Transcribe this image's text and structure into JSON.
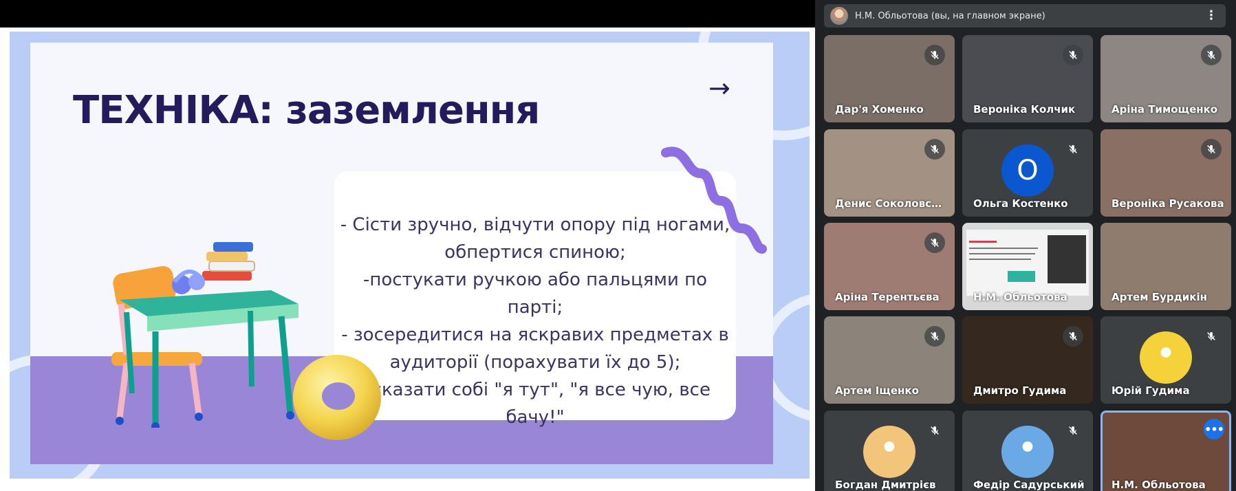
{
  "slide": {
    "title": "ТЕХНІКА: заземлення",
    "arrow": "→",
    "lines": [
      "- Сісти зручно, відчути опору під ногами,",
      "обпертися спиною;",
      "-постукати ручкою або пальцями по парті;",
      "- зосередитися на яскравих предметах в",
      "аудиторії (порахувати їх до 5);",
      "- сказати собі \"я тут\", \"я все чую, все бачу!\""
    ]
  },
  "pinned": {
    "label": "Н.М. Обльотова (вы, на главном экране)",
    "menu_icon": "more-vert-icon"
  },
  "participants": [
    {
      "name": "Дар'я Хоменко",
      "muted": true,
      "bg": "#7b6e67"
    },
    {
      "name": "Вероніка Колчик",
      "muted": true,
      "bg": "#4a4c51"
    },
    {
      "name": "Аріна Тимощенко",
      "muted": true,
      "bg": "#8d8682"
    },
    {
      "name": "Денис Соколовський",
      "muted": true,
      "bg": "#a39183"
    },
    {
      "name": "Ольга Костенко",
      "muted": true,
      "bg": "#3c4043",
      "initial": "О",
      "avatar_color": "#0b57d0"
    },
    {
      "name": "Вероніка Русакова",
      "muted": true,
      "bg": "#8a7064"
    },
    {
      "name": "Аріна Терентьєва",
      "muted": true,
      "bg": "#9e7c73"
    },
    {
      "name": "Н.М. Обльотова",
      "muted": false,
      "bg": "#d8d8d8",
      "presenting": true
    },
    {
      "name": "Артем Бурдикін",
      "muted": false,
      "bg": "#8e7c6e"
    },
    {
      "name": "Артем Іщенко",
      "muted": true,
      "bg": "#8c847b"
    },
    {
      "name": "Дмитро Гудима",
      "muted": true,
      "bg": "#35281e"
    },
    {
      "name": "Юрій Гудима",
      "muted": true,
      "bg": "#3c4043",
      "avatar_color": "#f5d23a"
    },
    {
      "name": "Богдан Дмитрієв",
      "muted": true,
      "bg": "#3c4043",
      "avatar_color": "#f3c57a"
    },
    {
      "name": "Федір Садурський",
      "muted": true,
      "bg": "#3c4043",
      "avatar_color": "#6ba9e6"
    },
    {
      "name": "Н.М. Обльотова",
      "muted": false,
      "bg": "#6d4a3c",
      "active": true
    }
  ],
  "colors": {
    "title": "#241b5c",
    "meet_bg": "#202124",
    "tile_bg": "#3c4043",
    "accent_blue": "#1a73e8",
    "slide_frame": "#b9cdf6",
    "floor": "#9a86d6"
  }
}
